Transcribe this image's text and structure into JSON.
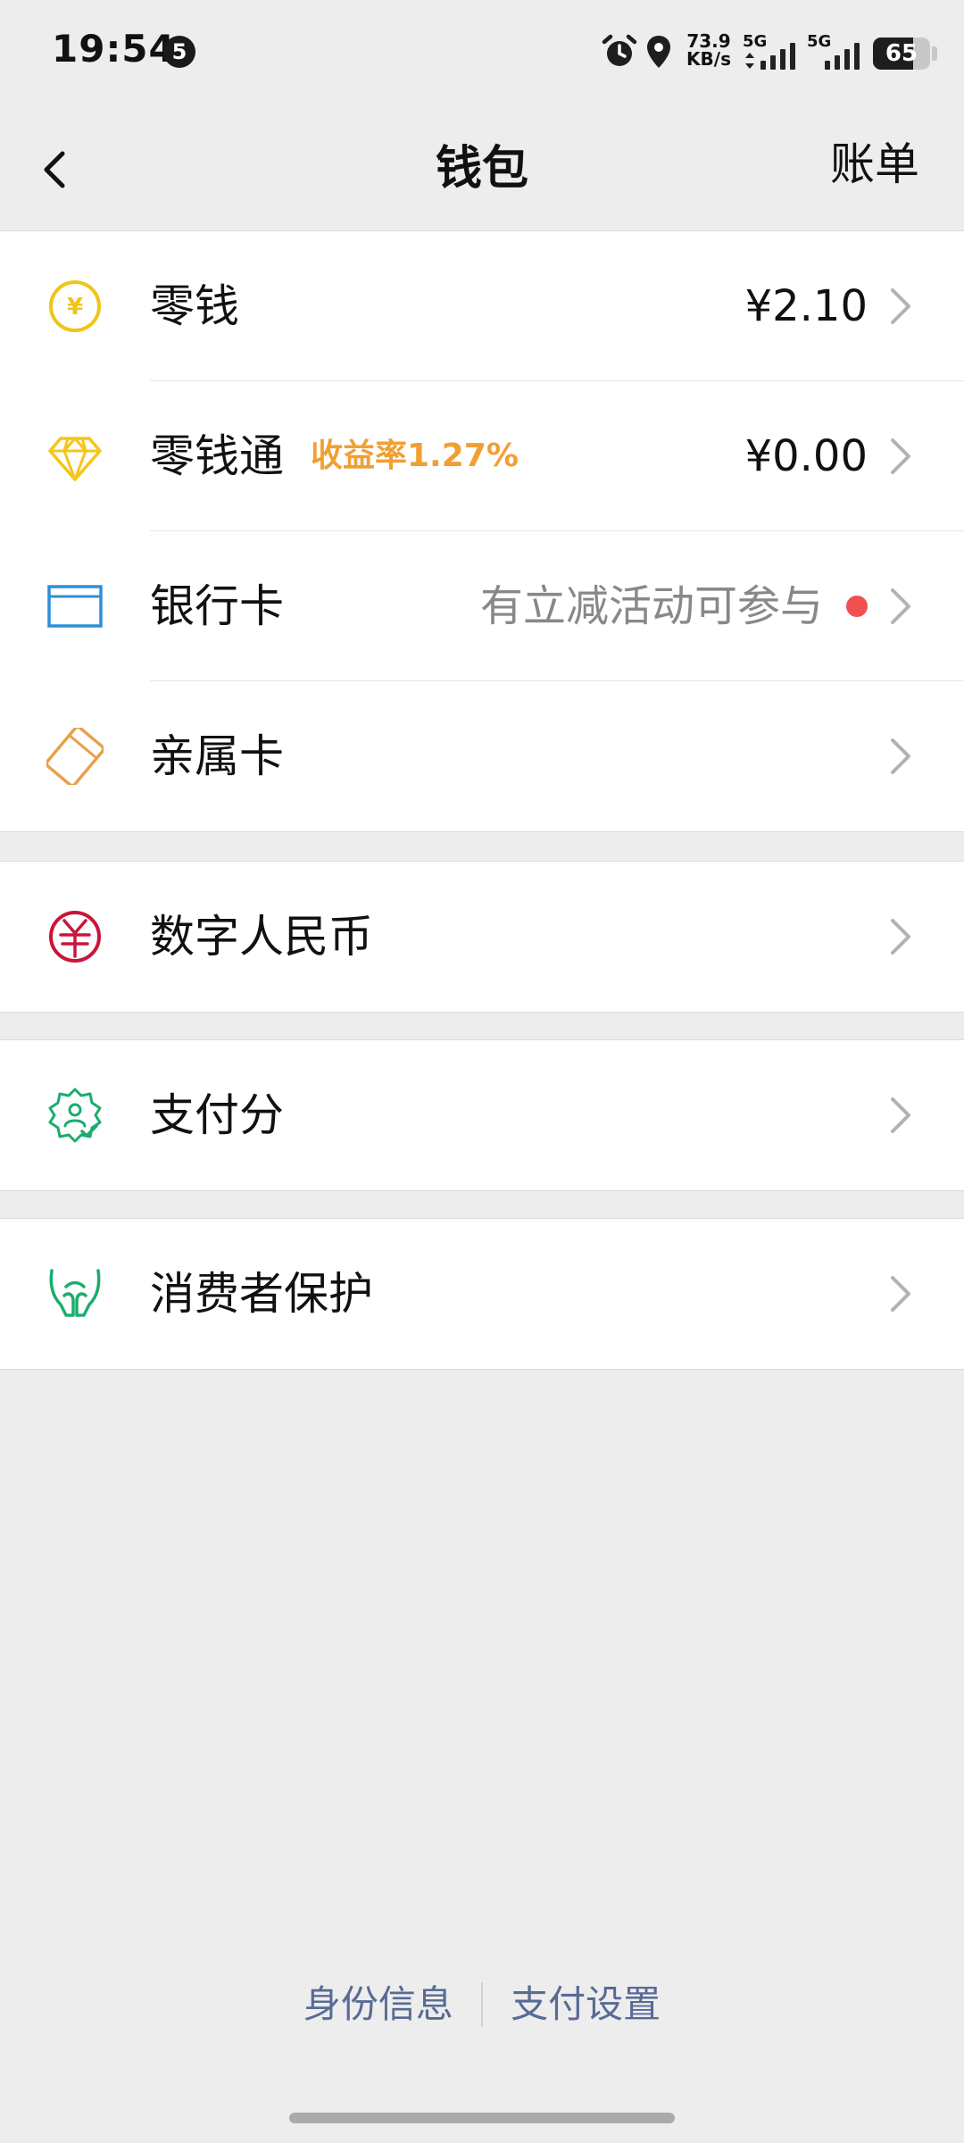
{
  "status": {
    "time": "19:54",
    "notification_count": "5",
    "net_speed_value": "73.9",
    "net_speed_unit": "KB/s",
    "sim1_label": "5G",
    "sim2_label": "5G",
    "battery": "65",
    "icons": [
      "alarm-icon",
      "location-icon",
      "signal-icon",
      "battery-icon"
    ]
  },
  "nav": {
    "title": "钱包",
    "right_label": "账单"
  },
  "groups": [
    {
      "items": [
        {
          "label": "零钱",
          "value": "¥2.10",
          "icon": "yuan-coin-icon",
          "color": "#f0c419"
        },
        {
          "label": "零钱通",
          "rate": "收益率1.27%",
          "value": "¥0.00",
          "icon": "diamond-icon",
          "color": "#f5c518"
        },
        {
          "label": "银行卡",
          "hint": "有立减活动可参与",
          "icon": "bank-card-icon",
          "color": "#2f8fd6"
        },
        {
          "label": "亲属卡",
          "icon": "family-card-icon",
          "color": "#e8a04a"
        }
      ]
    },
    {
      "items": [
        {
          "label": "数字人民币",
          "icon": "digital-rmb-icon",
          "color": "#c9163a"
        }
      ]
    },
    {
      "items": [
        {
          "label": "支付分",
          "icon": "pay-score-icon",
          "color": "#1aad6e"
        }
      ]
    },
    {
      "items": [
        {
          "label": "消费者保护",
          "icon": "consumer-protection-icon",
          "color": "#1aad6e"
        }
      ]
    }
  ],
  "footer": {
    "identity_label": "身份信息",
    "settings_label": "支付设置"
  },
  "colors": {
    "background": "#ededed",
    "link": "#576b95",
    "rate": "#f0a033",
    "badge": "#f05050"
  }
}
